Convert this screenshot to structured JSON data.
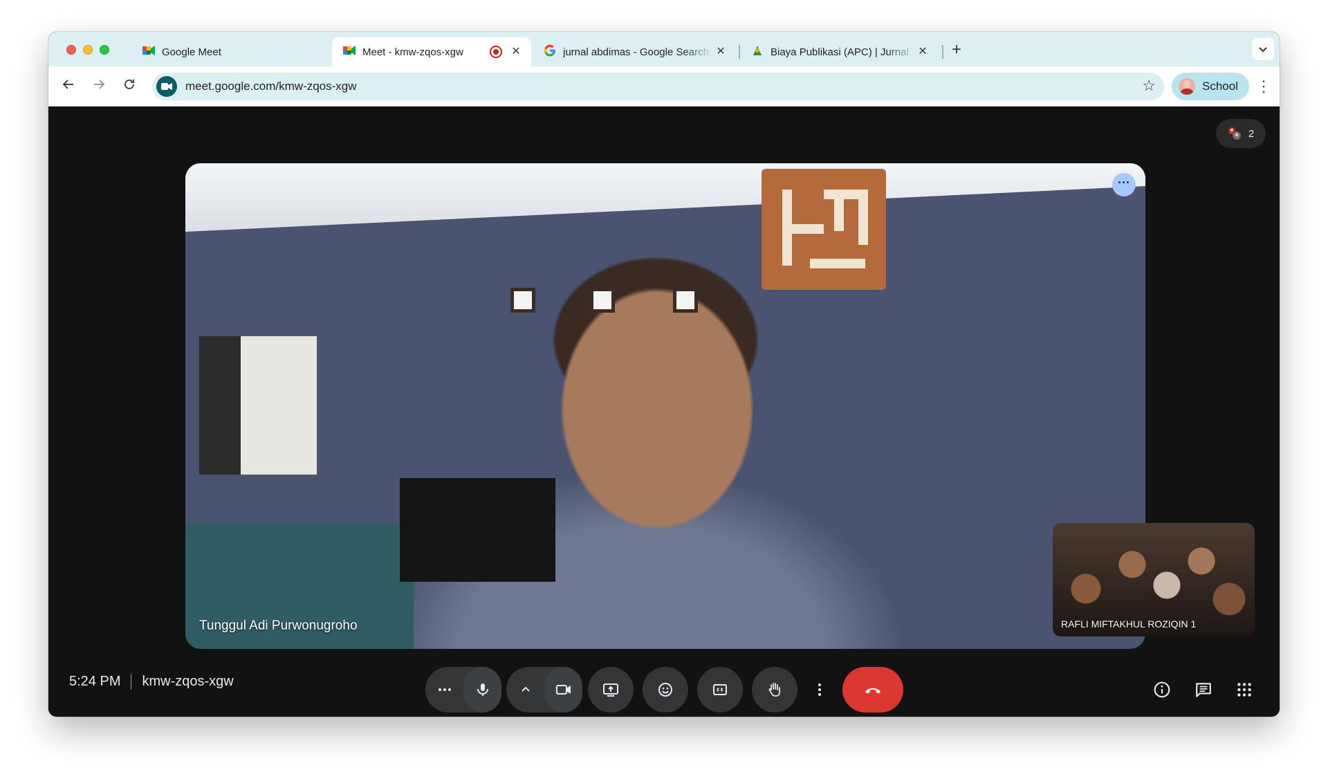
{
  "browser": {
    "tabs": [
      {
        "label": "Google Meet",
        "icon": "google-meet-icon"
      },
      {
        "label": "Meet - kmw-zqos-xgw",
        "icon": "google-meet-icon",
        "recording": true
      },
      {
        "label": "jurnal abdimas - Google Search",
        "icon": "google-g-icon"
      },
      {
        "label": "Biaya Publikasi (APC) | Jurnal",
        "icon": "journal-site-icon"
      }
    ],
    "url": "meet.google.com/kmw-zqos-xgw",
    "profile_label": "School"
  },
  "meet": {
    "participant_count": "2",
    "main_participant": "Tunggul Adi Purwonugroho",
    "self_participant": "RAFLI MIFTAKHUL ROZIQIN 1",
    "time": "5:24 PM",
    "meeting_code": "kmw-zqos-xgw",
    "colors": {
      "end_call": "#dc362e",
      "background": "#121212",
      "tile_menu": "#a8c7fa"
    }
  }
}
